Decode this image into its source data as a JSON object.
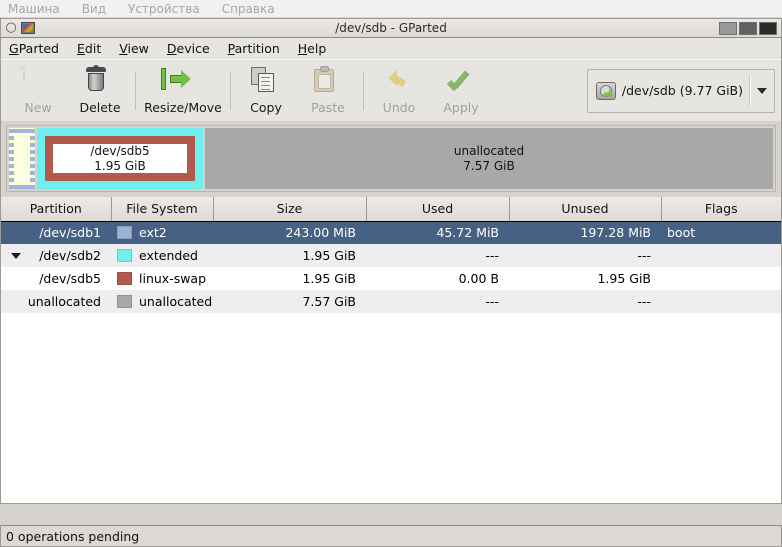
{
  "vm_menu": {
    "items": [
      {
        "label": "Машина",
        "name": "vm-menu-machine"
      },
      {
        "label": "Вид",
        "name": "vm-menu-view"
      },
      {
        "label": "Устройства",
        "name": "vm-menu-devices"
      },
      {
        "label": "Справка",
        "name": "vm-menu-help"
      }
    ]
  },
  "window": {
    "title": "/dev/sdb - GParted",
    "icon_left": "spiral-icon",
    "icon_app": "image-icon",
    "buttons": {
      "minimize": "minimize-button",
      "maximize": "maximize-button",
      "close": "close-button"
    }
  },
  "menubar": {
    "items": [
      {
        "mnemonic": "G",
        "rest": "Parted"
      },
      {
        "mnemonic": "E",
        "rest": "dit"
      },
      {
        "mnemonic": "V",
        "rest": "iew"
      },
      {
        "mnemonic": "D",
        "rest": "evice"
      },
      {
        "mnemonic": "P",
        "rest": "artition"
      },
      {
        "mnemonic": "H",
        "rest": "elp"
      }
    ]
  },
  "toolbar": {
    "new_label": "New",
    "delete_label": "Delete",
    "resize_label": "Resize/Move",
    "copy_label": "Copy",
    "paste_label": "Paste",
    "undo_label": "Undo",
    "apply_label": "Apply",
    "device_label": "/dev/sdb  (9.77 GiB)"
  },
  "diskmap": {
    "blocks": [
      {
        "name": "/dev/sdb1",
        "size": "",
        "kind": "ext2"
      },
      {
        "name": "/dev/sdb5",
        "size": "1.95 GiB",
        "kind": "linux-swap-in-extended"
      },
      {
        "name": "unallocated",
        "size": "7.57 GiB",
        "kind": "unallocated"
      }
    ]
  },
  "table": {
    "headers": [
      "Partition",
      "File System",
      "Size",
      "Used",
      "Unused",
      "Flags"
    ],
    "rows": [
      {
        "partition": "/dev/sdb1",
        "filesystem": "ext2",
        "size": "243.00 MiB",
        "used": "45.72 MiB",
        "unused": "197.28 MiB",
        "flags": "boot",
        "swatch": "#9cb3d4",
        "selected": true,
        "indent": 1,
        "expander": false
      },
      {
        "partition": "/dev/sdb2",
        "filesystem": "extended",
        "size": "1.95 GiB",
        "used": "---",
        "unused": "---",
        "flags": "",
        "swatch": "#6ff0ee",
        "selected": false,
        "indent": 1,
        "expander": true
      },
      {
        "partition": "/dev/sdb5",
        "filesystem": "linux-swap",
        "size": "1.95 GiB",
        "used": "0.00 B",
        "unused": "1.95 GiB",
        "flags": "",
        "swatch": "#b2594e",
        "selected": false,
        "indent": 2,
        "expander": false
      },
      {
        "partition": "unallocated",
        "filesystem": "unallocated",
        "size": "7.57 GiB",
        "used": "---",
        "unused": "---",
        "flags": "",
        "swatch": "#a8a8a8",
        "selected": false,
        "indent": 1,
        "expander": false
      }
    ]
  },
  "statusbar": {
    "text": "0 operations pending"
  },
  "colors": {
    "selection": "#466184",
    "ext2": "#9cb3d4",
    "extended": "#6ff0ee",
    "linux_swap": "#b2594e",
    "unallocated": "#a8a8a8",
    "chrome": "#e7e5e1"
  }
}
